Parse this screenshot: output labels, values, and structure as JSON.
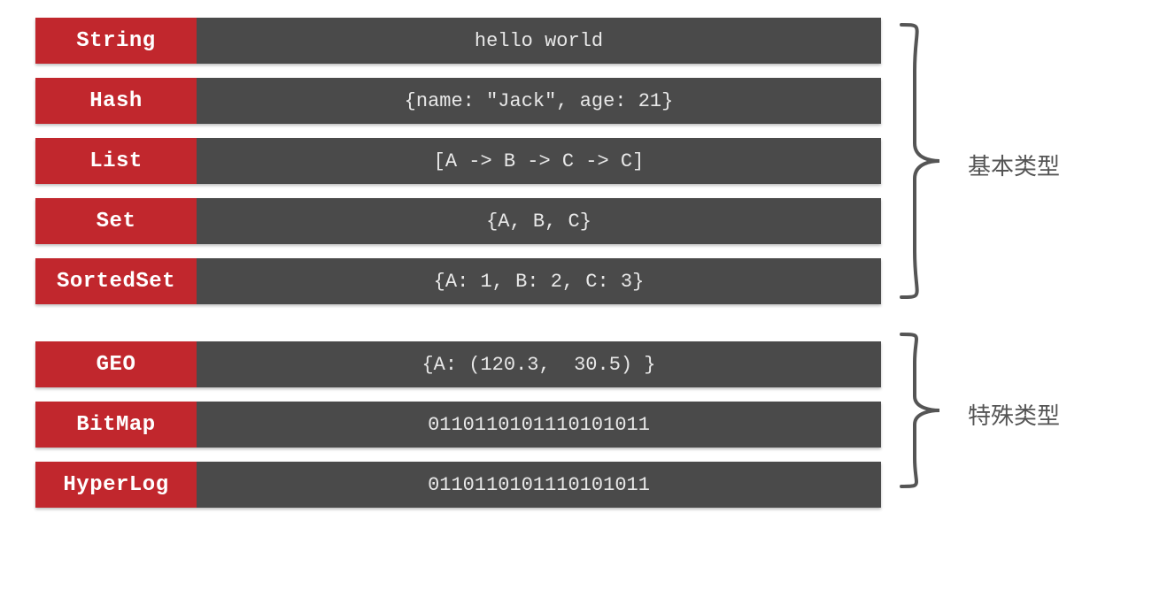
{
  "groups": [
    {
      "annotation": "基本类型",
      "rows": [
        {
          "name": "String",
          "value": "hello world"
        },
        {
          "name": "Hash",
          "value": "{name: \"Jack\", age: 21}"
        },
        {
          "name": "List",
          "value": "[A -> B -> C -> C]"
        },
        {
          "name": "Set",
          "value": "{A, B, C}"
        },
        {
          "name": "SortedSet",
          "value": "{A: 1, B: 2, C: 3}"
        }
      ]
    },
    {
      "annotation": "特殊类型",
      "rows": [
        {
          "name": "GEO",
          "value": "{A: (120.3,  30.5) }"
        },
        {
          "name": "BitMap",
          "value": "0110110101110101011"
        },
        {
          "name": "HyperLog",
          "value": "0110110101110101011"
        }
      ]
    }
  ]
}
